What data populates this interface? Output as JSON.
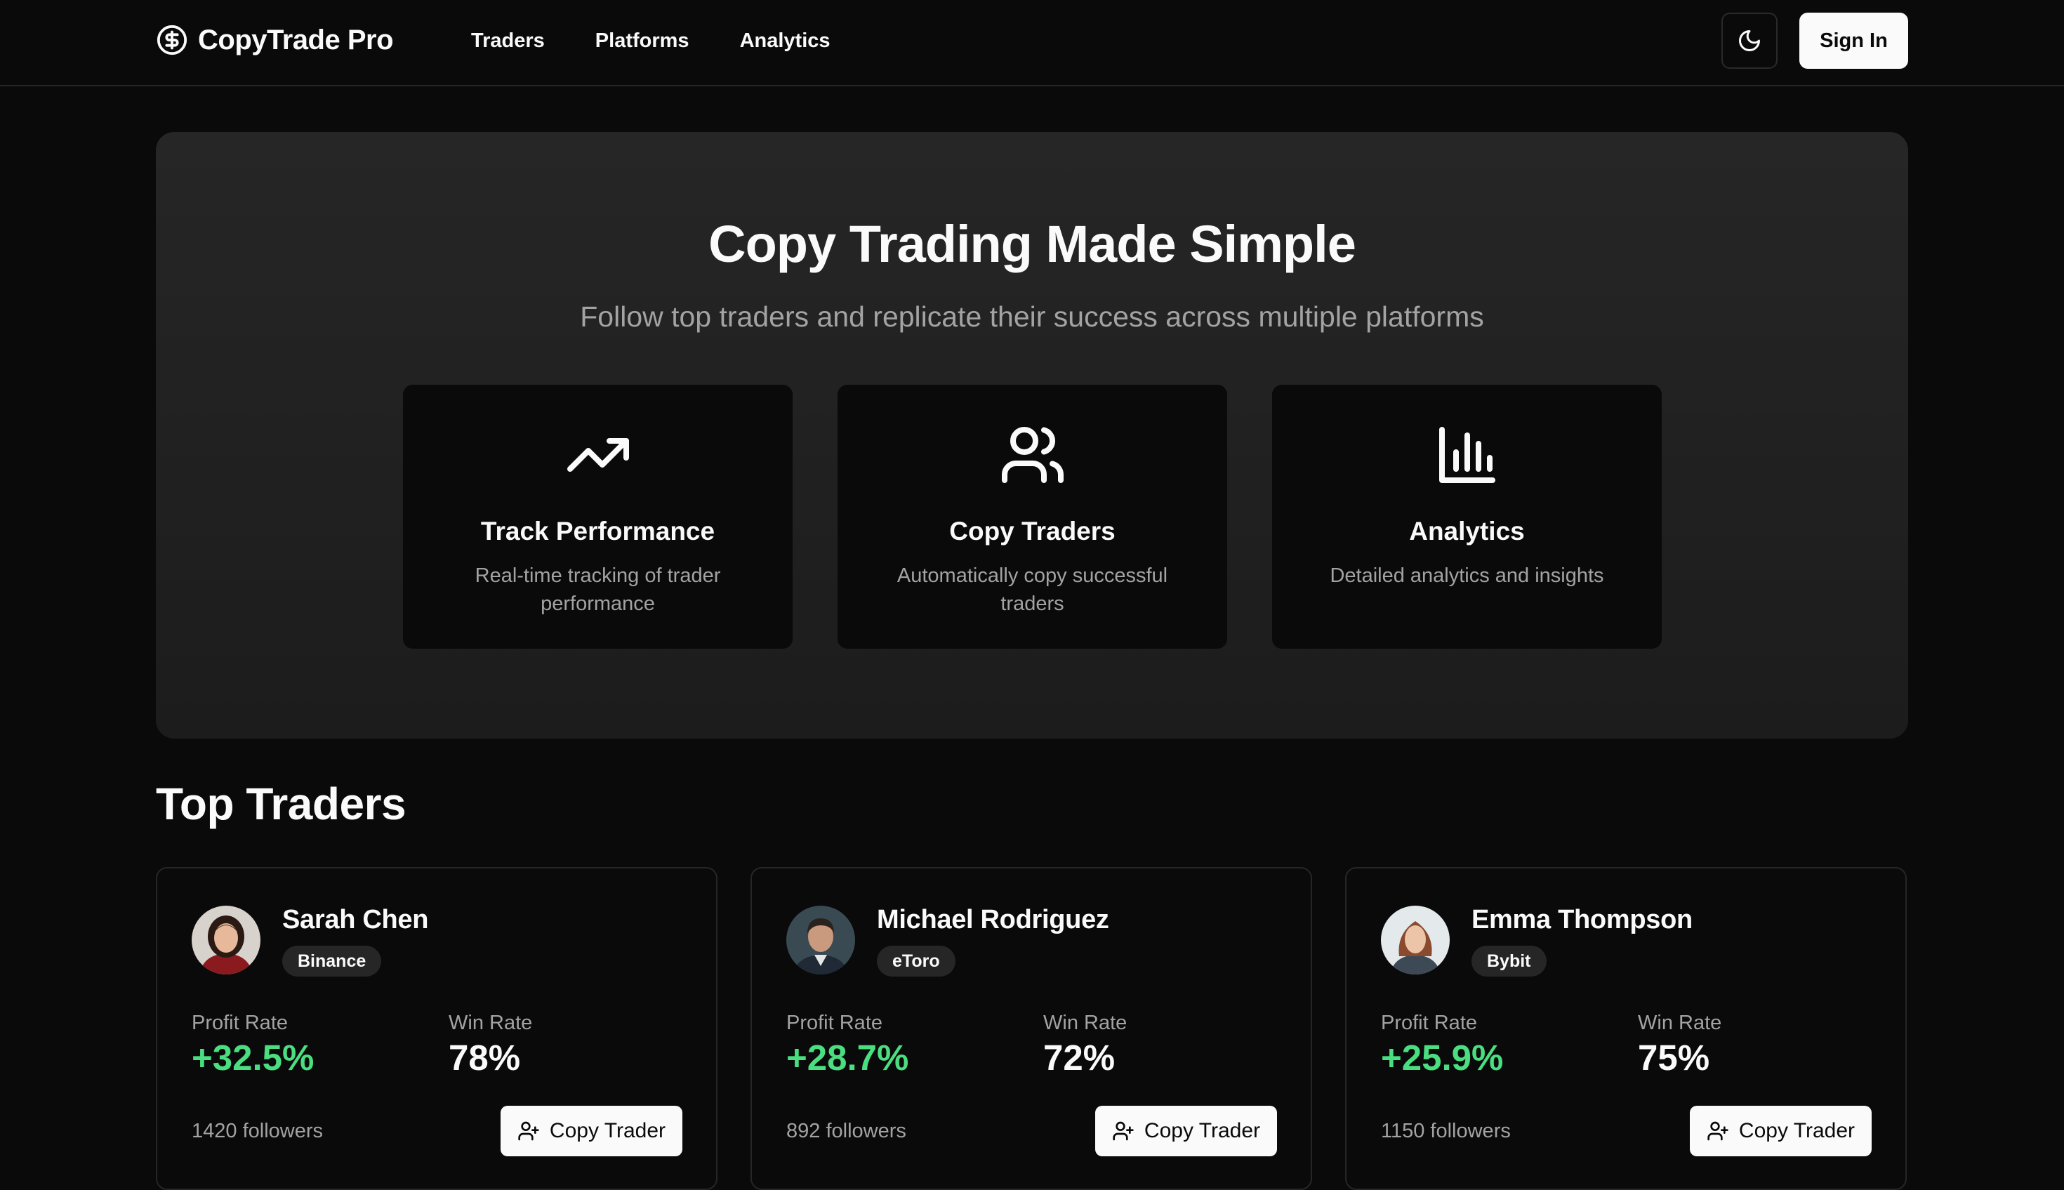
{
  "nav": {
    "brand": "CopyTrade Pro",
    "brand_icon": "dollar-circle-icon",
    "links": [
      "Traders",
      "Platforms",
      "Analytics"
    ],
    "theme_icon": "moon-icon",
    "signin_label": "Sign In"
  },
  "hero": {
    "title": "Copy Trading Made Simple",
    "subtitle": "Follow top traders and replicate their success across multiple platforms",
    "features": [
      {
        "icon": "trending-up-icon",
        "title": "Track Performance",
        "description": "Real-time tracking of trader performance"
      },
      {
        "icon": "users-icon",
        "title": "Copy Traders",
        "description": "Automatically copy successful traders"
      },
      {
        "icon": "bar-chart-icon",
        "title": "Analytics",
        "description": "Detailed analytics and insights"
      }
    ]
  },
  "top_traders": {
    "title": "Top Traders",
    "profit_label": "Profit Rate",
    "win_label": "Win Rate",
    "copy_label": "Copy Trader",
    "copy_icon": "user-plus-icon",
    "traders": [
      {
        "name": "Sarah Chen",
        "platform": "Binance",
        "profit_rate": "+32.5%",
        "win_rate": "78%",
        "followers": "1420 followers"
      },
      {
        "name": "Michael Rodriguez",
        "platform": "eToro",
        "profit_rate": "+28.7%",
        "win_rate": "72%",
        "followers": "892 followers"
      },
      {
        "name": "Emma Thompson",
        "platform": "Bybit",
        "profit_rate": "+25.9%",
        "win_rate": "75%",
        "followers": "1150 followers"
      }
    ]
  },
  "colors": {
    "background": "#0a0a0a",
    "hero_background": "#262626",
    "card_background": "#0a0a0a",
    "profit_green": "#4ade80",
    "muted_text": "#a3a3a3",
    "primary_button": "#fafafa"
  }
}
